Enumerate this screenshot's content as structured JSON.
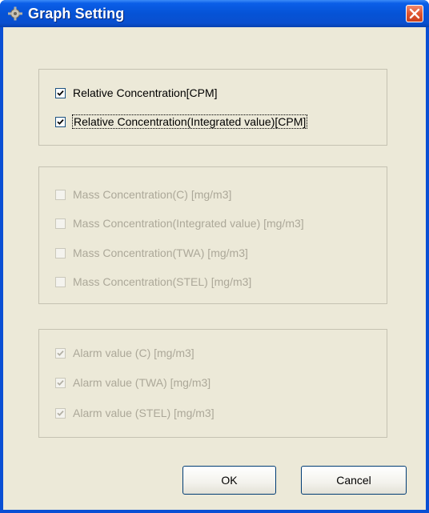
{
  "window": {
    "title": "Graph Setting",
    "icons": {
      "app": "gear-app-icon",
      "close": "close-icon"
    }
  },
  "relative_group": {
    "items": [
      {
        "label": "Relative Concentration[CPM]",
        "checked": true,
        "enabled": true
      },
      {
        "label": "Relative Concentration(Integrated value)[CPM]",
        "checked": true,
        "enabled": true,
        "focused": true
      }
    ]
  },
  "mass_group": {
    "items": [
      {
        "label": "Mass Concentration(C) [mg/m3]",
        "checked": false,
        "enabled": false
      },
      {
        "label": "Mass Concentration(Integrated value) [mg/m3]",
        "checked": false,
        "enabled": false
      },
      {
        "label": "Mass Concentration(TWA) [mg/m3]",
        "checked": false,
        "enabled": false
      },
      {
        "label": "Mass Concentration(STEL) [mg/m3]",
        "checked": false,
        "enabled": false
      }
    ]
  },
  "alarm_group": {
    "items": [
      {
        "label": "Alarm value (C) [mg/m3]",
        "checked": true,
        "enabled": false
      },
      {
        "label": "Alarm value (TWA) [mg/m3]",
        "checked": true,
        "enabled": false
      },
      {
        "label": "Alarm value (STEL) [mg/m3]",
        "checked": true,
        "enabled": false
      }
    ]
  },
  "buttons": {
    "ok": "OK",
    "cancel": "Cancel"
  },
  "colors": {
    "titlebar": "#0553d6",
    "dialog_bg": "#ece9d8",
    "close_button": "#e0552f",
    "disabled_text": "#aca899"
  }
}
